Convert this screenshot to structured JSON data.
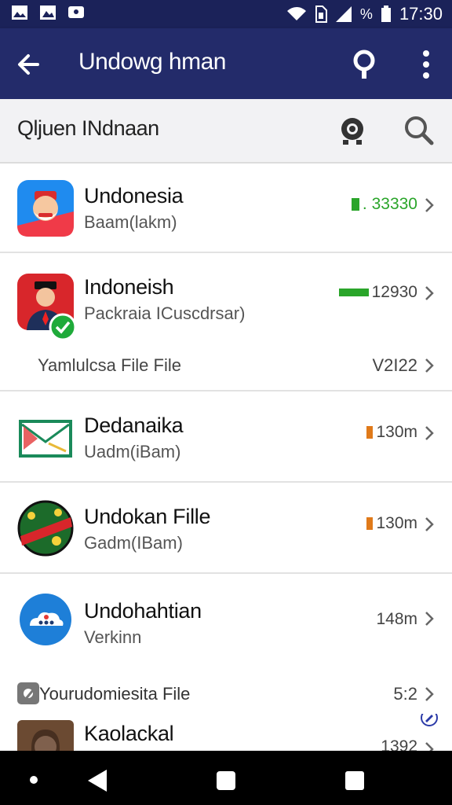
{
  "status_bar": {
    "time": "17:30",
    "battery_text": "%"
  },
  "app_bar": {
    "title": "Undowg hman",
    "back_icon": "arrow-left-icon",
    "pin_icon": "location-pin-icon",
    "more_icon": "more-vert-icon"
  },
  "search": {
    "query": "Qljuen INdnaan"
  },
  "colors": {
    "app_bar": "#232b6a",
    "status_bar": "#1b2259",
    "green": "#2aa52a",
    "orange": "#e07a1a"
  },
  "items": [
    {
      "name": "Undonesia",
      "sub": "Baam(lakm)",
      "meta": ". 33330"
    },
    {
      "name": "Indoneish",
      "sub": "Packraia ICuscdrsar)",
      "meta": "12930",
      "extra_label": "Yamlulcsa File File",
      "extra_meta": "V2I22"
    },
    {
      "name": "Dedanaika",
      "sub": "Uadm(iBam)",
      "meta": "130m"
    },
    {
      "name": "Undokan Fille",
      "sub": "Gadm(IBam)",
      "meta": "130m"
    },
    {
      "name": "Undohahtian",
      "sub": "Verkinn",
      "meta": "148m",
      "extra_label": "Yourudomiesita File",
      "extra_meta": "5:2"
    },
    {
      "name": "Kaolackal",
      "meta": "1392"
    }
  ]
}
